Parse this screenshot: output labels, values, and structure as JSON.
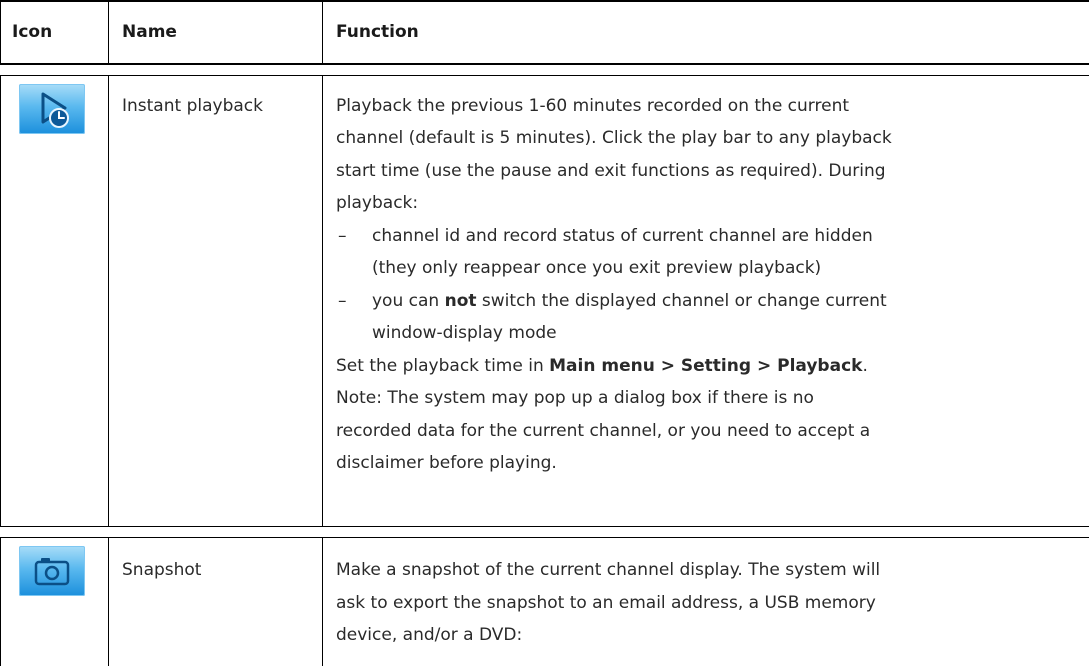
{
  "header": {
    "icon": "Icon",
    "name": "Name",
    "function": "Function"
  },
  "rows": [
    {
      "icon": "instant-playback-icon",
      "name": "Instant playback",
      "lines": [
        "Playback the previous 1-60 minutes recorded on the current",
        "channel (default is 5 minutes). Click the play bar to any playback",
        "start time (use the pause and exit functions as required). During",
        "playback:"
      ],
      "bullets": [
        {
          "dash": "–",
          "line1": "channel id and record status of current channel are hidden",
          "line2": "(they only reappear once you exit preview playback)"
        },
        {
          "dash": "–",
          "pre": "you can ",
          "bold": "not",
          "post": " switch the displayed channel or change current",
          "line2": "window-display mode"
        }
      ],
      "setting_pre": "Set the playback time in ",
      "setting_bold": "Main menu > Setting > Playback",
      "setting_post": ".",
      "note": [
        "Note: The system may pop up a dialog box if there is no",
        "recorded data for the current channel, or you need to accept a",
        "disclaimer before playing."
      ]
    },
    {
      "icon": "camera-icon",
      "name": "Snapshot",
      "lines": [
        "Make a snapshot of the current channel display. The system will",
        "ask to export the snapshot to an email address, a USB memory",
        "device, and/or a DVD:"
      ]
    }
  ]
}
